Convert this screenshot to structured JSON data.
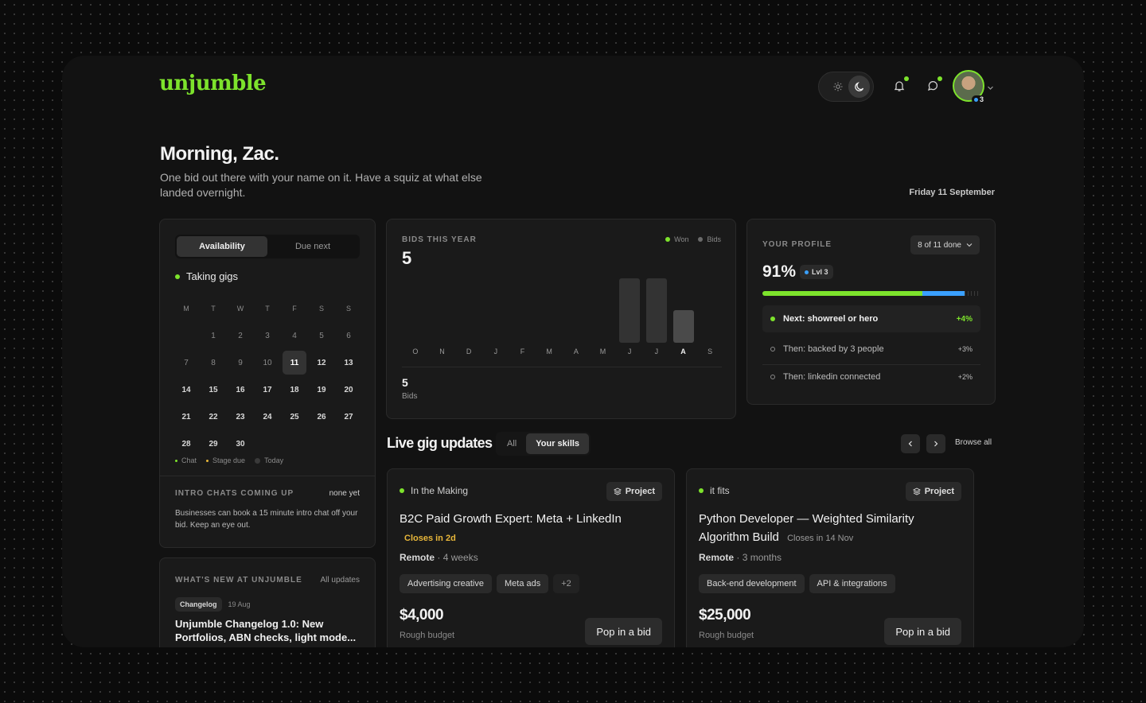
{
  "app": {
    "logo": "unjumble"
  },
  "header": {
    "avatar_badge": "3"
  },
  "greeting": {
    "title": "Morning, Zac.",
    "subtitle": "One bid out there with your name on it. Have a squiz at what else landed overnight.",
    "date": "Friday 11 September"
  },
  "availability": {
    "tabs": [
      "Availability",
      "Due next"
    ],
    "status": "Taking gigs",
    "weekdays": [
      "M",
      "T",
      "W",
      "T",
      "F",
      "S",
      "S"
    ],
    "days": [
      [
        "",
        "1",
        "2",
        "3",
        "4",
        "5",
        "6"
      ],
      [
        "7",
        "8",
        "9",
        "10",
        "11",
        "12",
        "13"
      ],
      [
        "14",
        "15",
        "16",
        "17",
        "18",
        "19",
        "20"
      ],
      [
        "21",
        "22",
        "23",
        "24",
        "25",
        "26",
        "27"
      ],
      [
        "28",
        "29",
        "30",
        "",
        "",
        "",
        ""
      ]
    ],
    "today": "11",
    "legend": [
      "Chat",
      "Stage due",
      "Today"
    ],
    "intro_title": "INTRO CHATS COMING UP",
    "intro_status": "none yet",
    "intro_text": "Businesses can book a 15 minute intro chat off your bid. Keep an eye out."
  },
  "whats_new": {
    "title": "WHAT'S NEW AT UNJUMBLE",
    "link": "All updates",
    "tag": "Changelog",
    "date": "19 Aug",
    "headline": "Unjumble Changelog 1.0: New Portfolios, ABN checks, light mode..."
  },
  "bids": {
    "title": "BIDS THIS YEAR",
    "total": "5",
    "legend_won": "Won",
    "legend_bids": "Bids",
    "footer_value": "5",
    "footer_label": "Bids",
    "colors": {
      "won": "#7de32c",
      "bids": "#6a6a6a"
    }
  },
  "chart_data": {
    "type": "bar",
    "categories": [
      "O",
      "N",
      "D",
      "J",
      "F",
      "M",
      "A",
      "M",
      "J",
      "J",
      "A",
      "S"
    ],
    "series": [
      {
        "name": "Bids",
        "values": [
          0,
          0,
          0,
          0,
          0,
          0,
          0,
          0,
          2,
          2,
          1,
          0
        ]
      }
    ],
    "current_category_index": 10,
    "ylim": [
      0,
      2
    ]
  },
  "profile": {
    "title": "YOUR PROFILE",
    "done": "8 of 11 done",
    "percent": "91%",
    "level": "Lvl 3",
    "progress_green": 0.72,
    "progress_blue": 0.19,
    "next": {
      "label": "Next: showreel or hero",
      "gain": "+4%"
    },
    "steps": [
      {
        "label": "Then: backed by 3 people",
        "gain": "+3%"
      },
      {
        "label": "Then: linkedin connected",
        "gain": "+2%"
      }
    ]
  },
  "live": {
    "title": "Live gig updates",
    "filters": [
      "All",
      "Your skills"
    ],
    "browse": "Browse all"
  },
  "gigs": [
    {
      "stage": "In the Making",
      "type": "Project",
      "title": "B2C Paid Growth Expert: Meta + LinkedIn",
      "closes": "Closes in 2d",
      "location": "Remote",
      "duration": "· 4 weeks",
      "tags": [
        "Advertising creative",
        "Meta ads",
        "+2"
      ],
      "budget": "$4,000",
      "budget_label": "Rough budget",
      "cta": "Pop in a bid"
    },
    {
      "stage": "it fits",
      "type": "Project",
      "title": "Python Developer — Weighted Similarity Algorithm Build",
      "closes": "Closes in 14 Nov",
      "location": "Remote",
      "duration": "· 3 months",
      "tags": [
        "Back-end development",
        "API & integrations"
      ],
      "budget": "$25,000",
      "budget_label": "Rough budget",
      "cta": "Pop in a bid"
    }
  ]
}
